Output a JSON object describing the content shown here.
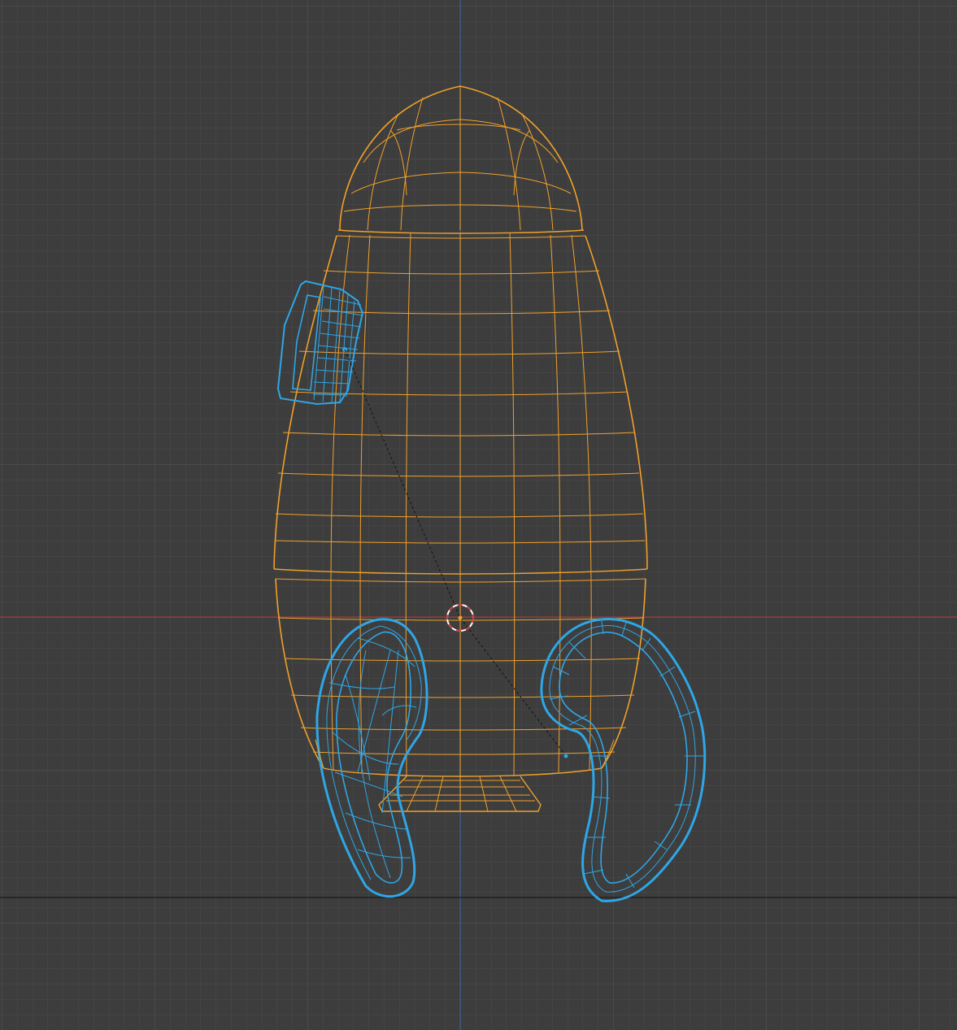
{
  "viewport": {
    "background": "#3d3d3d",
    "grid_minor_color": "#444444",
    "grid_major_color": "#4a4a4a",
    "x_axis_color": "#b33a3a",
    "y_axis_color": "#3a5fa8",
    "floor_line_color": "#111111"
  },
  "objects": [
    {
      "name": "body",
      "kind": "mesh",
      "selected": true,
      "color": "#f0a02a"
    },
    {
      "name": "engine-nozzle",
      "kind": "mesh",
      "selected": true,
      "color": "#f0a02a"
    },
    {
      "name": "window-panel",
      "kind": "mesh",
      "selected": false,
      "color": "#2fa6e6"
    },
    {
      "name": "left-leg-loop",
      "kind": "mesh",
      "selected": false,
      "color": "#2fa6e6"
    },
    {
      "name": "right-leg-loop",
      "kind": "mesh",
      "selected": false,
      "color": "#2fa6e6"
    }
  ],
  "cursor": {
    "icon": "3d-cursor-icon",
    "ring_colors": [
      "#d23a3a",
      "#ffffff"
    ]
  },
  "relationship_line": {
    "style": "dashed",
    "color": "#111111"
  }
}
